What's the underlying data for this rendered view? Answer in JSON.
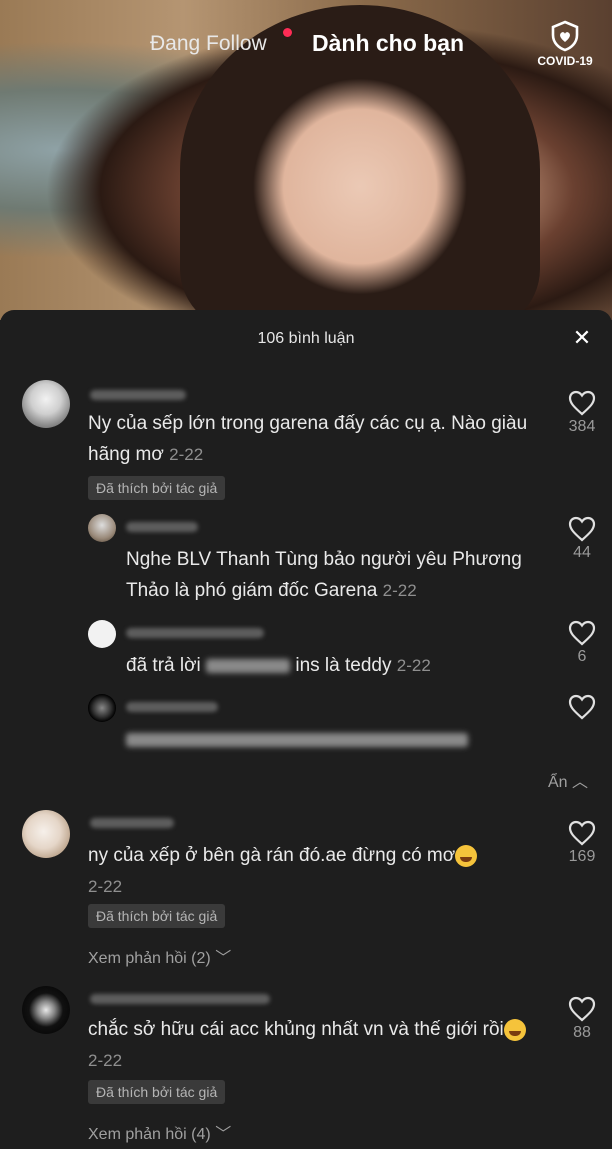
{
  "header": {
    "tab_following": "Đang Follow",
    "tab_for_you": "Dành cho bạn",
    "covid_label": "COVID-19"
  },
  "comments_panel": {
    "title": "106 bình luận",
    "hide_label": "Ẩn",
    "comments": [
      {
        "text": "Ny của sếp lớn trong garena đấy các cụ ạ. Nào giàu hãng mơ",
        "date": "2-22",
        "likes": "384",
        "badge": "Đã thích bởi tác giả",
        "replies": [
          {
            "text": "Nghe BLV Thanh Tùng bảo người yêu Phương Thảo là phó giám đốc Garena",
            "date": "2-22",
            "likes": "44"
          },
          {
            "text_prefix": "đã trả lời",
            "text_suffix": "ins là teddy",
            "date": "2-22",
            "likes": "6"
          },
          {
            "likes": ""
          }
        ]
      },
      {
        "text": "ny của xếp ở bên gà rán đó.ae đừng có mơ",
        "date": "2-22",
        "likes": "169",
        "badge": "Đã thích bởi tác giả",
        "view_replies": "Xem phản hồi (2)"
      },
      {
        "text": "chắc sở hữu cái acc khủng nhất vn và thế giới rồi",
        "date": "2-22",
        "likes": "88",
        "badge": "Đã thích bởi tác giả",
        "view_replies": "Xem phản hồi (4)"
      }
    ]
  }
}
